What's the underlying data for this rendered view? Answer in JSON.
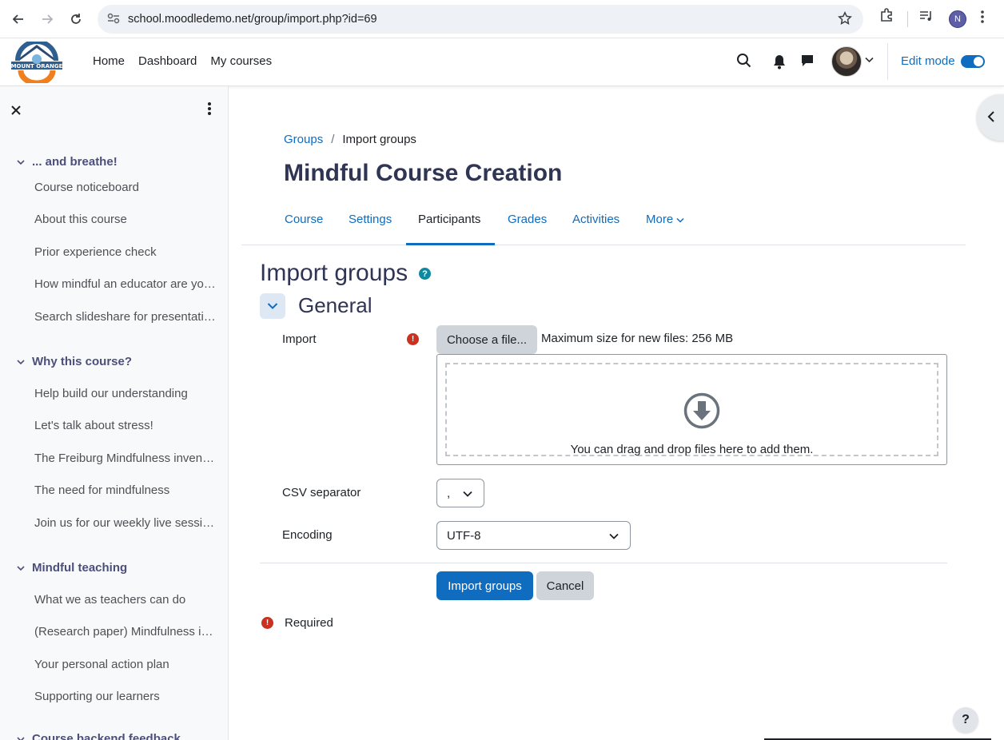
{
  "browser": {
    "url": "school.moodledemo.net/group/import.php?id=69",
    "profile_initial": "N"
  },
  "navbar": {
    "logo_text": "MOUNT ORANGE",
    "links": [
      "Home",
      "Dashboard",
      "My courses"
    ],
    "edit_mode_label": "Edit mode",
    "edit_mode_on": true
  },
  "drawer": {
    "sections": [
      {
        "title": "... and breathe!",
        "items": [
          "Course noticeboard",
          "About this course",
          "Prior experience check",
          "How mindful an educator are you?",
          "Search slideshare for presentations"
        ]
      },
      {
        "title": "Why this course?",
        "items": [
          "Help build our understanding",
          "Let's talk about stress!",
          "The Freiburg Mindfulness inventory",
          "The need for mindfulness",
          "Join us for our weekly live sessions"
        ]
      },
      {
        "title": "Mindful teaching",
        "items": [
          "What we as teachers can do",
          "(Research paper) Mindfulness in education",
          "Your personal action plan",
          "Supporting our learners"
        ]
      },
      {
        "title": "Course backend feedback",
        "items": []
      }
    ]
  },
  "breadcrumb": {
    "link": "Groups",
    "separator": "/",
    "current": "Import groups"
  },
  "page_title": "Mindful Course Creation",
  "secondary_nav": {
    "tabs": [
      "Course",
      "Settings",
      "Participants",
      "Grades",
      "Activities",
      "More"
    ],
    "active": "Participants"
  },
  "form": {
    "heading": "Import groups",
    "help_glyph": "?",
    "section_title": "General",
    "import_label": "Import",
    "required_glyph": "!",
    "choose_file_label": "Choose a file...",
    "max_size_text": "Maximum size for new files: 256 MB",
    "dropzone_text": "You can drag and drop files here to add them.",
    "csv_separator_label": "CSV separator",
    "csv_separator_value": ",",
    "encoding_label": "Encoding",
    "encoding_value": "UTF-8",
    "submit_label": "Import groups",
    "cancel_label": "Cancel",
    "required_note": "Required"
  },
  "floating_help": "?",
  "colors": {
    "brand_blue": "#0f6cbf",
    "heading": "#2f3553",
    "required_red": "#ca3120",
    "help_teal": "#0e8aa0"
  }
}
